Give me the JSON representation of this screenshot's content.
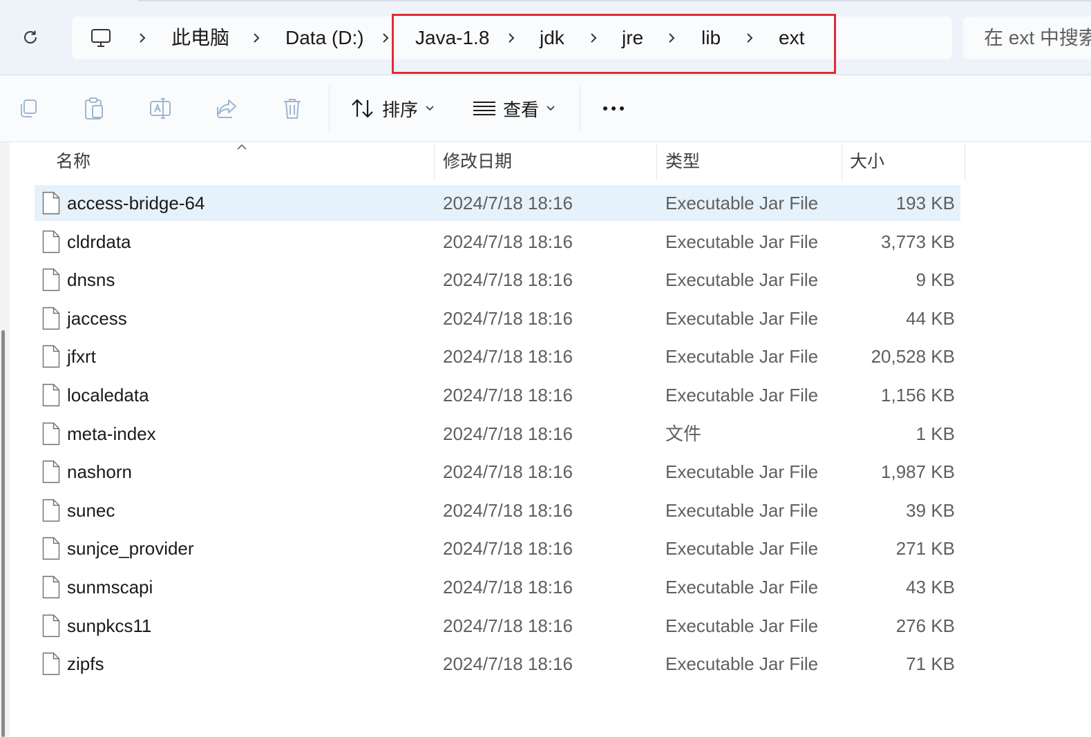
{
  "address": {
    "crumbs": [
      "此电脑",
      "Data (D:)",
      "Java-1.8",
      "jdk",
      "jre",
      "lib",
      "ext"
    ],
    "search_placeholder": "在 ext 中搜索"
  },
  "toolbar": {
    "sort_label": "排序",
    "view_label": "查看"
  },
  "columns": {
    "name": "名称",
    "date": "修改日期",
    "type": "类型",
    "size": "大小"
  },
  "files": [
    {
      "name": "access-bridge-64",
      "date": "2024/7/18 18:16",
      "type": "Executable Jar File",
      "size": "193 KB"
    },
    {
      "name": "cldrdata",
      "date": "2024/7/18 18:16",
      "type": "Executable Jar File",
      "size": "3,773 KB"
    },
    {
      "name": "dnsns",
      "date": "2024/7/18 18:16",
      "type": "Executable Jar File",
      "size": "9 KB"
    },
    {
      "name": "jaccess",
      "date": "2024/7/18 18:16",
      "type": "Executable Jar File",
      "size": "44 KB"
    },
    {
      "name": "jfxrt",
      "date": "2024/7/18 18:16",
      "type": "Executable Jar File",
      "size": "20,528 KB"
    },
    {
      "name": "localedata",
      "date": "2024/7/18 18:16",
      "type": "Executable Jar File",
      "size": "1,156 KB"
    },
    {
      "name": "meta-index",
      "date": "2024/7/18 18:16",
      "type": "文件",
      "size": "1 KB"
    },
    {
      "name": "nashorn",
      "date": "2024/7/18 18:16",
      "type": "Executable Jar File",
      "size": "1,987 KB"
    },
    {
      "name": "sunec",
      "date": "2024/7/18 18:16",
      "type": "Executable Jar File",
      "size": "39 KB"
    },
    {
      "name": "sunjce_provider",
      "date": "2024/7/18 18:16",
      "type": "Executable Jar File",
      "size": "271 KB"
    },
    {
      "name": "sunmscapi",
      "date": "2024/7/18 18:16",
      "type": "Executable Jar File",
      "size": "43 KB"
    },
    {
      "name": "sunpkcs11",
      "date": "2024/7/18 18:16",
      "type": "Executable Jar File",
      "size": "276 KB"
    },
    {
      "name": "zipfs",
      "date": "2024/7/18 18:16",
      "type": "Executable Jar File",
      "size": "71 KB"
    }
  ],
  "selected_index": 0,
  "colors": {
    "highlight_box": "#e02b35",
    "selected_row": "#e5f1fb"
  }
}
